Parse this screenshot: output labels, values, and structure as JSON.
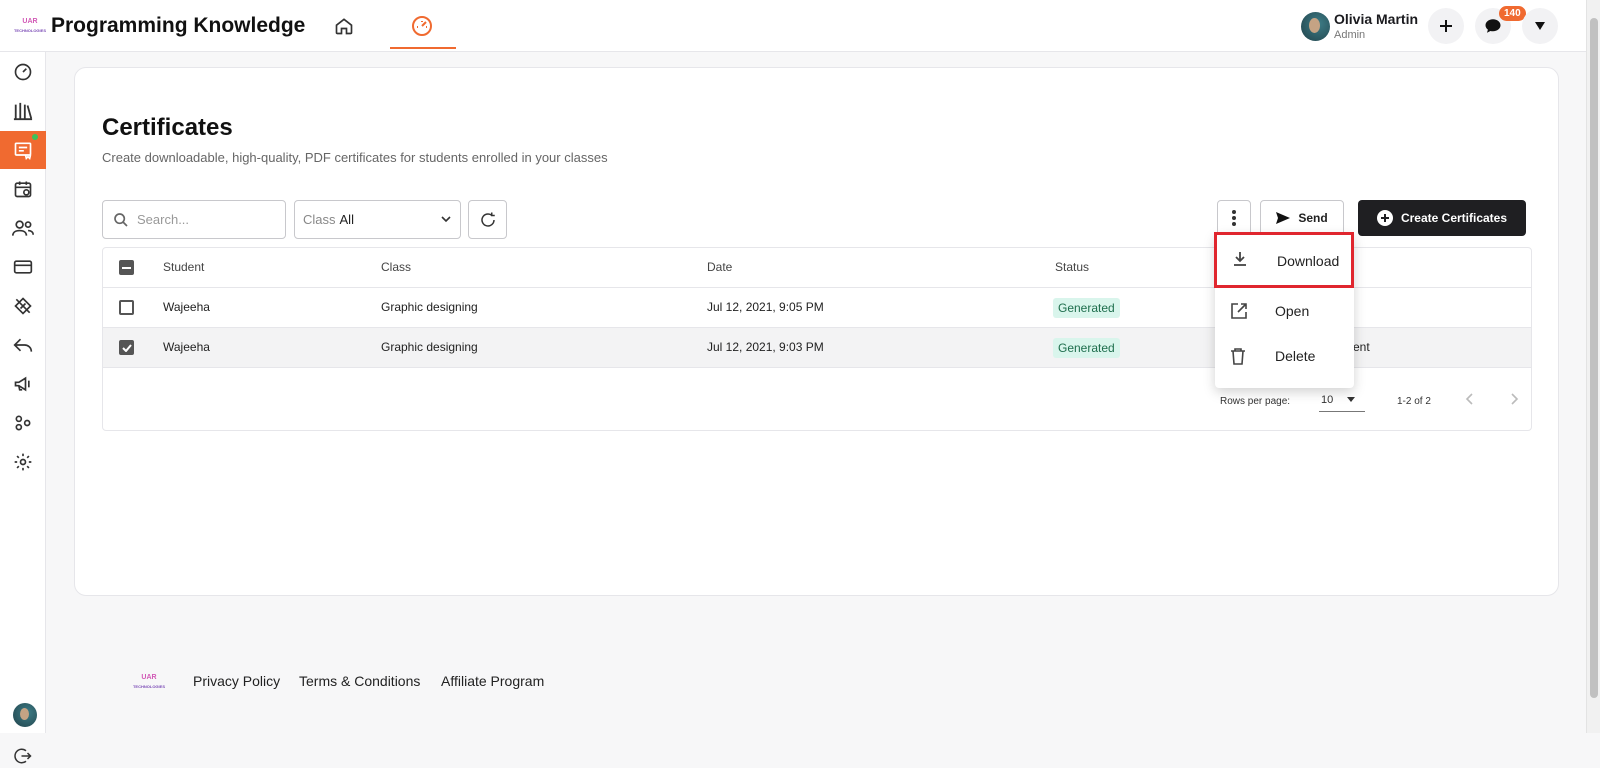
{
  "app": {
    "title": "Programming Knowledge",
    "logo_line1": "UAR",
    "logo_line2": "TECHNOLOGIES"
  },
  "user": {
    "name": "Olivia Martin",
    "role": "Admin"
  },
  "notifications": {
    "count": "140"
  },
  "colors": {
    "accent": "#f06a30",
    "highlight": "#e0262e",
    "status_bg": "#d9f5ec"
  },
  "sidebar": {
    "items": [
      {
        "icon": "dashboard-icon"
      },
      {
        "icon": "library-icon"
      },
      {
        "icon": "certificate-icon",
        "active": true
      },
      {
        "icon": "calendar-icon"
      },
      {
        "icon": "users-icon"
      },
      {
        "icon": "credit-card-icon"
      },
      {
        "icon": "coupon-icon"
      },
      {
        "icon": "reply-icon"
      },
      {
        "icon": "megaphone-icon"
      },
      {
        "icon": "integrations-icon"
      },
      {
        "icon": "settings-icon"
      }
    ]
  },
  "page": {
    "title": "Certificates",
    "subtitle": "Create downloadable, high-quality, PDF certificates for students enrolled in your classes"
  },
  "toolbar": {
    "search_placeholder": "Search...",
    "class_label": "Class",
    "class_value": "All",
    "send_label": "Send",
    "create_label": "Create Certificates"
  },
  "table": {
    "headers": {
      "student": "Student",
      "class": "Class",
      "date": "Date",
      "status": "Status"
    },
    "rows": [
      {
        "student": "Wajeeha",
        "class": "Graphic designing",
        "date": "Jul 12, 2021, 9:05 PM",
        "status": "Generated",
        "extra": "",
        "checked": false
      },
      {
        "student": "Wajeeha",
        "class": "Graphic designing",
        "date": "Jul 12, 2021, 9:03 PM",
        "status": "Generated",
        "extra": "ent",
        "checked": true
      }
    ],
    "rows_per_page_label": "Rows per page:",
    "rows_per_page": "10",
    "page_info": "1-2 of 2"
  },
  "menu": {
    "items": [
      {
        "label": "Download",
        "icon": "download-icon",
        "highlighted": true
      },
      {
        "label": "Open",
        "icon": "open-external-icon"
      },
      {
        "label": "Delete",
        "icon": "trash-icon"
      }
    ]
  },
  "footer": {
    "links": [
      "Privacy Policy",
      "Terms & Conditions",
      "Affiliate Program"
    ]
  }
}
